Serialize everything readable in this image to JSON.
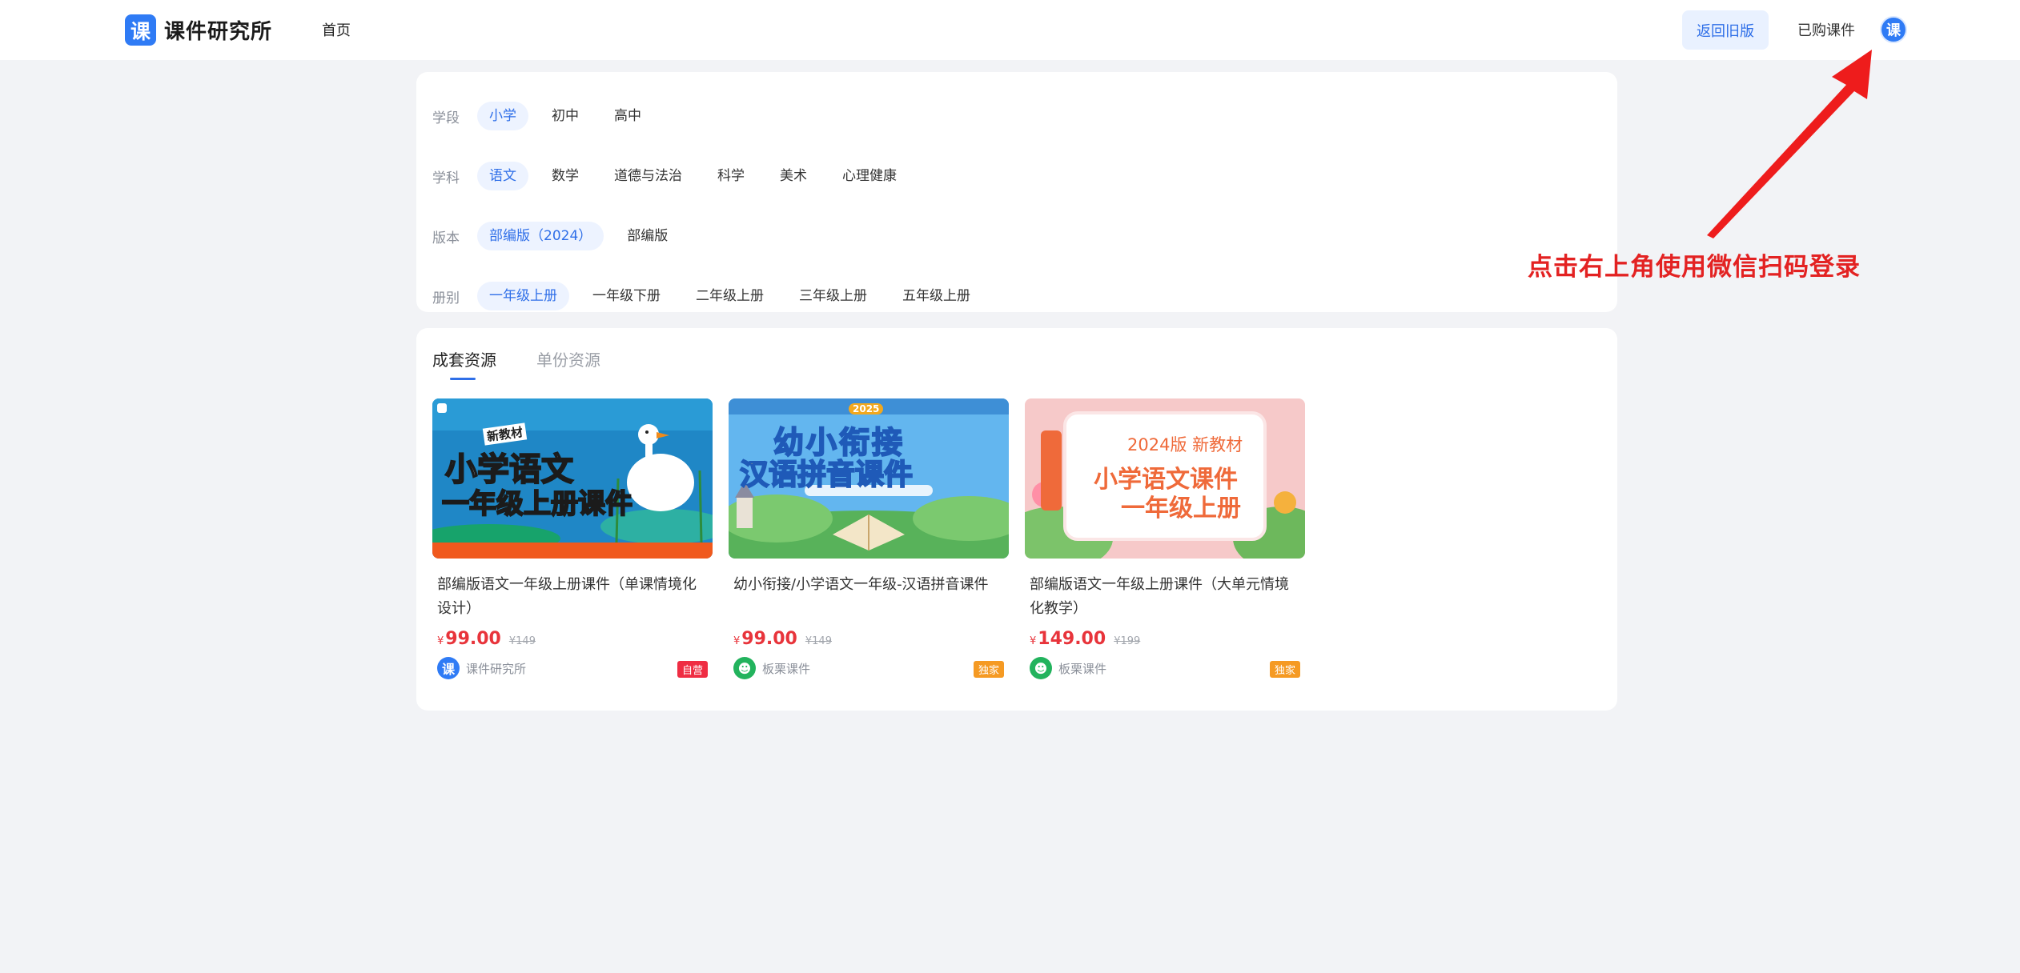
{
  "header": {
    "logo_glyph": "课",
    "logo_text": "课件研究所",
    "nav_home": "首页",
    "back_old": "返回旧版",
    "purchased": "已购课件",
    "avatar_glyph": "课"
  },
  "filters": {
    "stage": {
      "label": "学段",
      "options": [
        "小学",
        "初中",
        "高中"
      ],
      "selected": "小学"
    },
    "subject": {
      "label": "学科",
      "options": [
        "语文",
        "数学",
        "道德与法治",
        "科学",
        "美术",
        "心理健康"
      ],
      "selected": "语文"
    },
    "edition": {
      "label": "版本",
      "options": [
        "部编版（2024）",
        "部编版"
      ],
      "selected": "部编版（2024）"
    },
    "volume": {
      "label": "册别",
      "options": [
        "一年级上册",
        "一年级下册",
        "二年级上册",
        "三年级上册",
        "五年级上册"
      ],
      "selected": "一年级上册"
    }
  },
  "tabs": [
    "成套资源",
    "单份资源"
  ],
  "active_tab": "成套资源",
  "cards": [
    {
      "thumb": {
        "tag": "新教材",
        "line1": "小学语文",
        "line2": "一年级上册课件",
        "bg": "#1f87c6",
        "accent": "#f0591d"
      },
      "title": "部编版语文一年级上册课件（单课情境化设计）",
      "currency": "¥",
      "price": "99.00",
      "original_price": "¥149",
      "shop": "课件研究所",
      "shop_glyph": "课",
      "shop_color": "#2f7bf5",
      "badge": "自营",
      "badge_color": "#ef2d43"
    },
    {
      "thumb": {
        "tag": "2025",
        "line1": "幼小衔接",
        "line2": "汉语拼音课件",
        "bg": "#63b6ef",
        "accent": "#ffe24a"
      },
      "title": "幼小衔接/小学语文一年级-汉语拼音课件",
      "currency": "¥",
      "price": "99.00",
      "original_price": "¥149",
      "shop": "板栗课件",
      "shop_glyph": "☻",
      "shop_color": "#22b35d",
      "badge": "独家",
      "badge_color": "#f59a23"
    },
    {
      "thumb": {
        "tag": "2024版 新教材",
        "line1": "小学语文课件",
        "line2": "一年级上册",
        "bg": "#f6c9c9",
        "accent": "#ef6a3a"
      },
      "title": "部编版语文一年级上册课件（大单元情境化教学）",
      "currency": "¥",
      "price": "149.00",
      "original_price": "¥199",
      "shop": "板栗课件",
      "shop_glyph": "☻",
      "shop_color": "#22b35d",
      "badge": "独家",
      "badge_color": "#f59a23"
    }
  ],
  "annotation": "点击右上角使用微信扫码登录"
}
